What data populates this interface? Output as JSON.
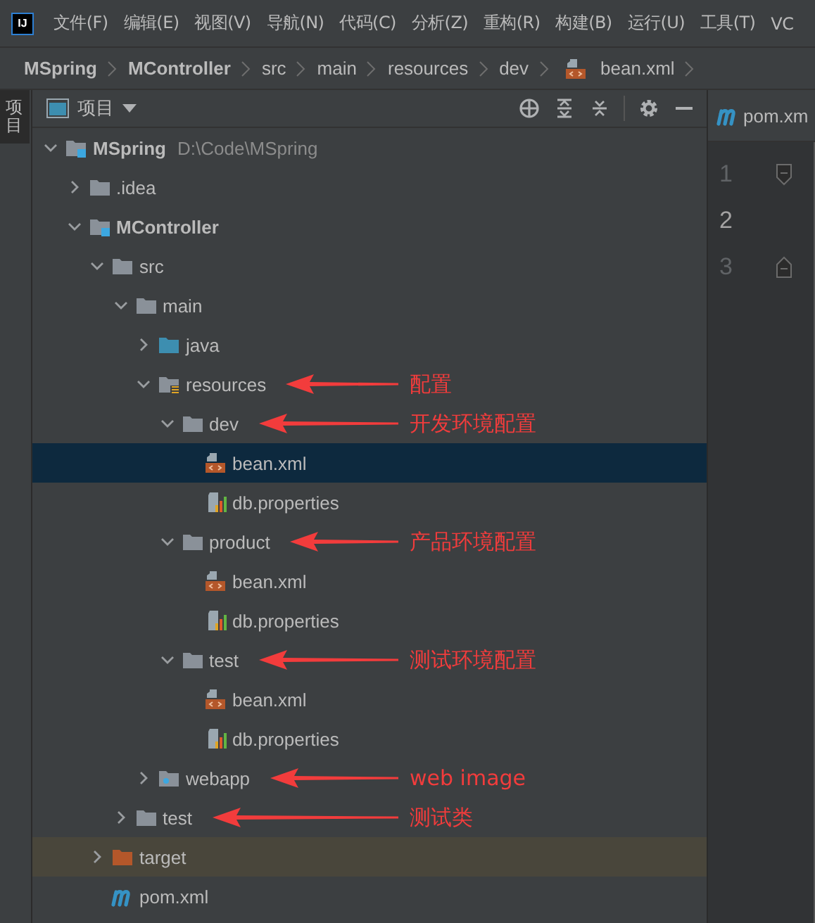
{
  "app_logo": "IJ",
  "menu": [
    "文件(F)",
    "编辑(E)",
    "视图(V)",
    "导航(N)",
    "代码(C)",
    "分析(Z)",
    "重构(R)",
    "构建(B)",
    "运行(U)",
    "工具(T)",
    "VC"
  ],
  "breadcrumb": [
    {
      "label": "MSpring",
      "kind": "module"
    },
    {
      "label": "MController",
      "kind": "module"
    },
    {
      "label": "src",
      "kind": "folder"
    },
    {
      "label": "main",
      "kind": "folder"
    },
    {
      "label": "resources",
      "kind": "folder"
    },
    {
      "label": "dev",
      "kind": "folder"
    },
    {
      "label": "bean.xml",
      "kind": "xml"
    }
  ],
  "side_tab": {
    "label": "项目",
    "selected": true
  },
  "panel": {
    "title": "项目"
  },
  "tree": [
    {
      "label": "MSpring",
      "path": "D:\\Code\\MSpring",
      "kind": "module",
      "expanded": true,
      "selected": false,
      "children": [
        {
          "label": ".idea",
          "kind": "folder",
          "expanded": false,
          "selected": false
        },
        {
          "label": "MController",
          "kind": "module",
          "expanded": true,
          "selected": false,
          "children": [
            {
              "label": "src",
              "kind": "folder",
              "expanded": true,
              "selected": false,
              "children": [
                {
                  "label": "main",
                  "kind": "folder",
                  "expanded": true,
                  "selected": false,
                  "children": [
                    {
                      "label": "java",
                      "kind": "source",
                      "expanded": false,
                      "selected": false
                    },
                    {
                      "label": "resources",
                      "kind": "resources",
                      "expanded": true,
                      "selected": false,
                      "note": "配置",
                      "children": [
                        {
                          "label": "dev",
                          "kind": "folder",
                          "expanded": true,
                          "selected": false,
                          "note": "开发环境配置",
                          "children": [
                            {
                              "label": "bean.xml",
                              "kind": "xml",
                              "selected": true
                            },
                            {
                              "label": "db.properties",
                              "kind": "properties",
                              "selected": false
                            }
                          ]
                        },
                        {
                          "label": "product",
                          "kind": "folder",
                          "expanded": true,
                          "selected": false,
                          "note": "产品环境配置",
                          "children": [
                            {
                              "label": "bean.xml",
                              "kind": "xml",
                              "selected": false
                            },
                            {
                              "label": "db.properties",
                              "kind": "properties",
                              "selected": false
                            }
                          ]
                        },
                        {
                          "label": "test",
                          "kind": "folder",
                          "expanded": true,
                          "selected": false,
                          "note": "测试环境配置",
                          "children": [
                            {
                              "label": "bean.xml",
                              "kind": "xml",
                              "selected": false
                            },
                            {
                              "label": "db.properties",
                              "kind": "properties",
                              "selected": false
                            }
                          ]
                        }
                      ]
                    },
                    {
                      "label": "webapp",
                      "kind": "web",
                      "expanded": false,
                      "selected": false,
                      "note": "web image"
                    }
                  ]
                },
                {
                  "label": "test",
                  "kind": "folder",
                  "expanded": false,
                  "selected": false,
                  "note": "测试类"
                }
              ]
            },
            {
              "label": "target",
              "kind": "excluded",
              "expanded": false,
              "selected": false
            },
            {
              "label": "pom.xml",
              "kind": "maven",
              "selected": false
            }
          ]
        }
      ]
    }
  ],
  "editor": {
    "tab": {
      "label": "pom.xm",
      "kind": "maven"
    },
    "lines": [
      {
        "number": "1",
        "selected": false
      },
      {
        "number": "2",
        "selected": true
      },
      {
        "number": "3",
        "selected": false
      }
    ]
  }
}
